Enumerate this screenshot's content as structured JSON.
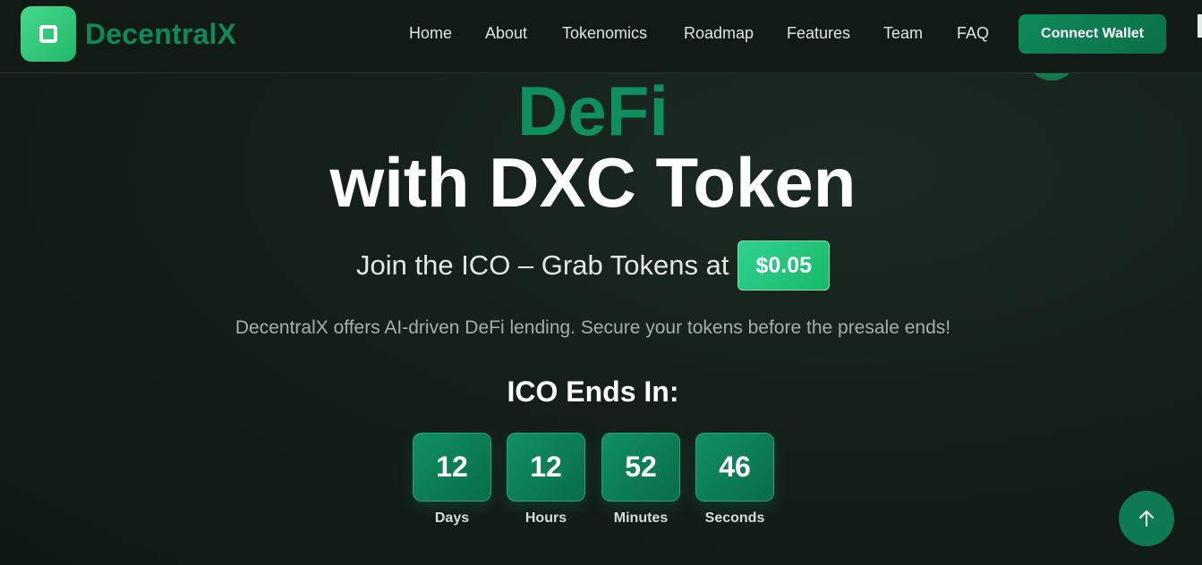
{
  "brand": {
    "name": "DecentralX",
    "icon": "square-logo-icon"
  },
  "nav": {
    "links": [
      "Home",
      "About",
      "Tokenomics",
      "Roadmap",
      "Features",
      "Team",
      "FAQ"
    ],
    "cta": "Connect Wallet"
  },
  "hero": {
    "accent_line": "DeFi",
    "title": "with DXC Token",
    "ico_text": "Join the ICO – Grab Tokens at",
    "price": "$0.05",
    "subtitle": "DecentralX offers AI-driven DeFi lending. Secure your tokens before the presale ends!"
  },
  "countdown": {
    "title": "ICO Ends In:",
    "units": [
      {
        "value": "12",
        "label": "Days"
      },
      {
        "value": "12",
        "label": "Hours"
      },
      {
        "value": "52",
        "label": "Minutes"
      },
      {
        "value": "46",
        "label": "Seconds"
      }
    ]
  },
  "scroll_top": {
    "icon": "arrow-up-icon"
  },
  "colors": {
    "accent": "#0f8f5d",
    "accent_bright": "#2fd18f",
    "background": "#15201a",
    "text": "#ffffff"
  }
}
